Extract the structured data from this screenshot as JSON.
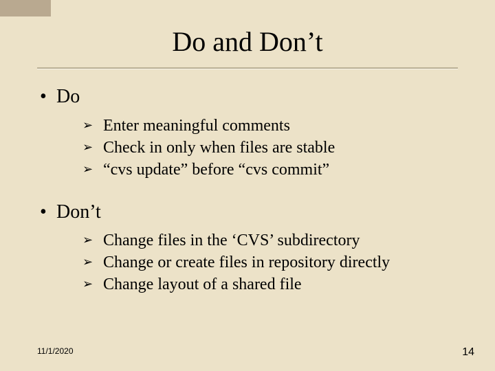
{
  "title": "Do and Don’t",
  "sections": [
    {
      "heading": "Do",
      "items": [
        "Enter meaningful comments",
        "Check in only when files are stable",
        "“cvs update” before “cvs commit”"
      ]
    },
    {
      "heading": "Don’t",
      "items": [
        "Change files in the ‘CVS’ subdirectory",
        "Change or create files in repository directly",
        "Change layout of a shared file"
      ]
    }
  ],
  "footer": {
    "date": "11/1/2020",
    "page": "14"
  },
  "bullets": {
    "l1": "•",
    "l2": "➢"
  }
}
